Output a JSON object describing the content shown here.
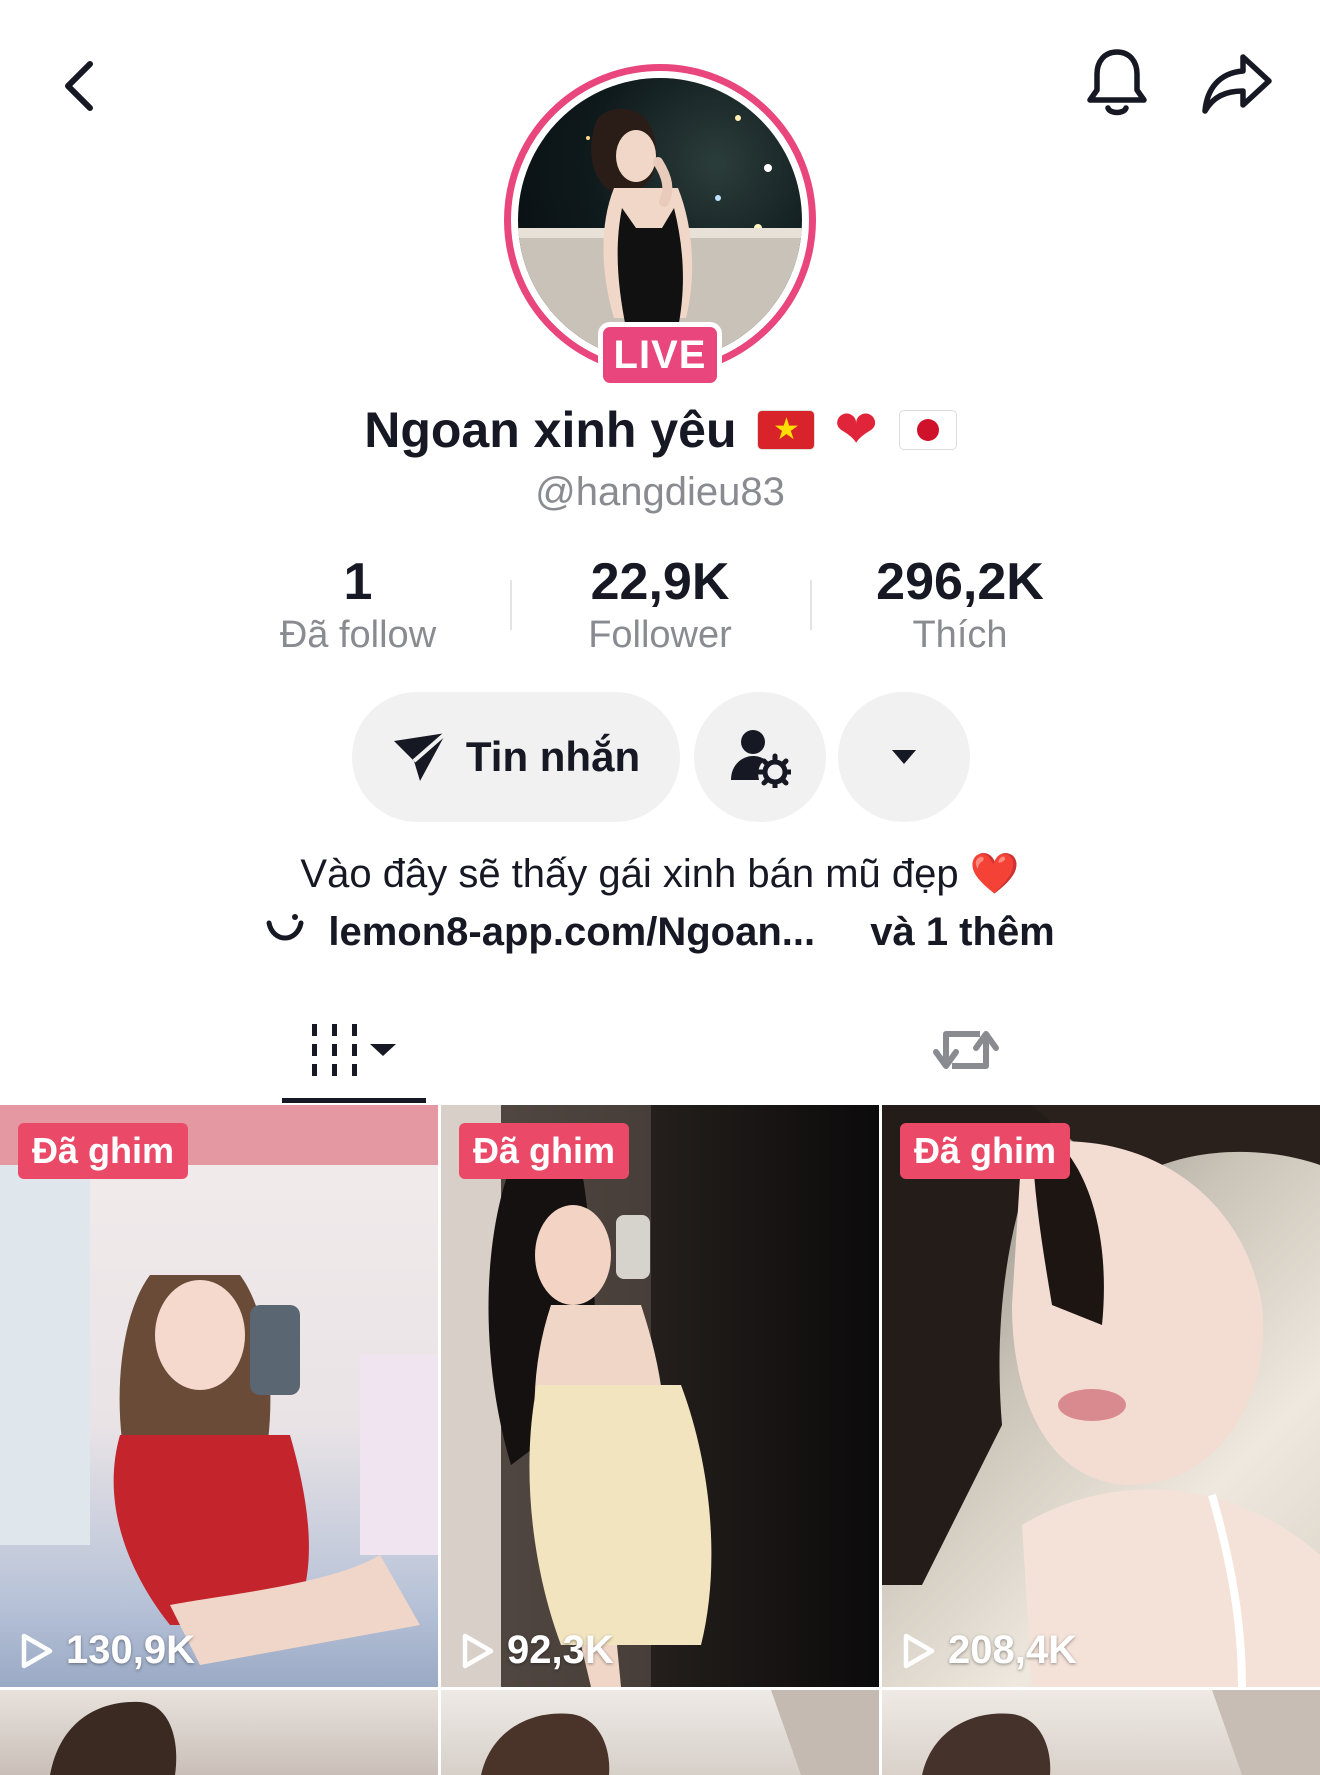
{
  "header": {
    "back_icon": "chevron-left-icon",
    "notification_icon": "bell-icon",
    "share_icon": "share-arrow-icon"
  },
  "profile": {
    "live_label": "LIVE",
    "display_name": "Ngoan xinh yêu",
    "name_emojis": [
      "flag-vietnam",
      "red-heart",
      "flag-japan"
    ],
    "username": "@hangdieu83"
  },
  "stats": [
    {
      "value": "1",
      "label": "Đã follow"
    },
    {
      "value": "22,9K",
      "label": "Follower"
    },
    {
      "value": "296,2K",
      "label": "Thích"
    }
  ],
  "actions": {
    "message_label": "Tin nhắn",
    "profile_settings_icon": "user-gear-icon",
    "dropdown_icon": "caret-down-icon"
  },
  "bio": {
    "text": "Vào đây sẽ thấy gái xinh bán mũ đẹp ❤️",
    "link": "lemon8-app.com/Ngoan...",
    "more": "và 1 thêm"
  },
  "tabs": [
    {
      "name": "videos",
      "icon": "grid-videos-icon",
      "active": true
    },
    {
      "name": "reposts",
      "icon": "repost-icon",
      "active": false
    }
  ],
  "videos": [
    {
      "pinned_label": "Đã ghim",
      "views": "130,9K"
    },
    {
      "pinned_label": "Đã ghim",
      "views": "92,3K"
    },
    {
      "pinned_label": "Đã ghim",
      "views": "208,4K"
    }
  ],
  "colors": {
    "accent_pink": "#e8467c",
    "pin_badge": "#ea4a68",
    "text_primary": "#161823",
    "text_secondary": "#8a8b91",
    "button_bg": "#f1f1f2"
  }
}
